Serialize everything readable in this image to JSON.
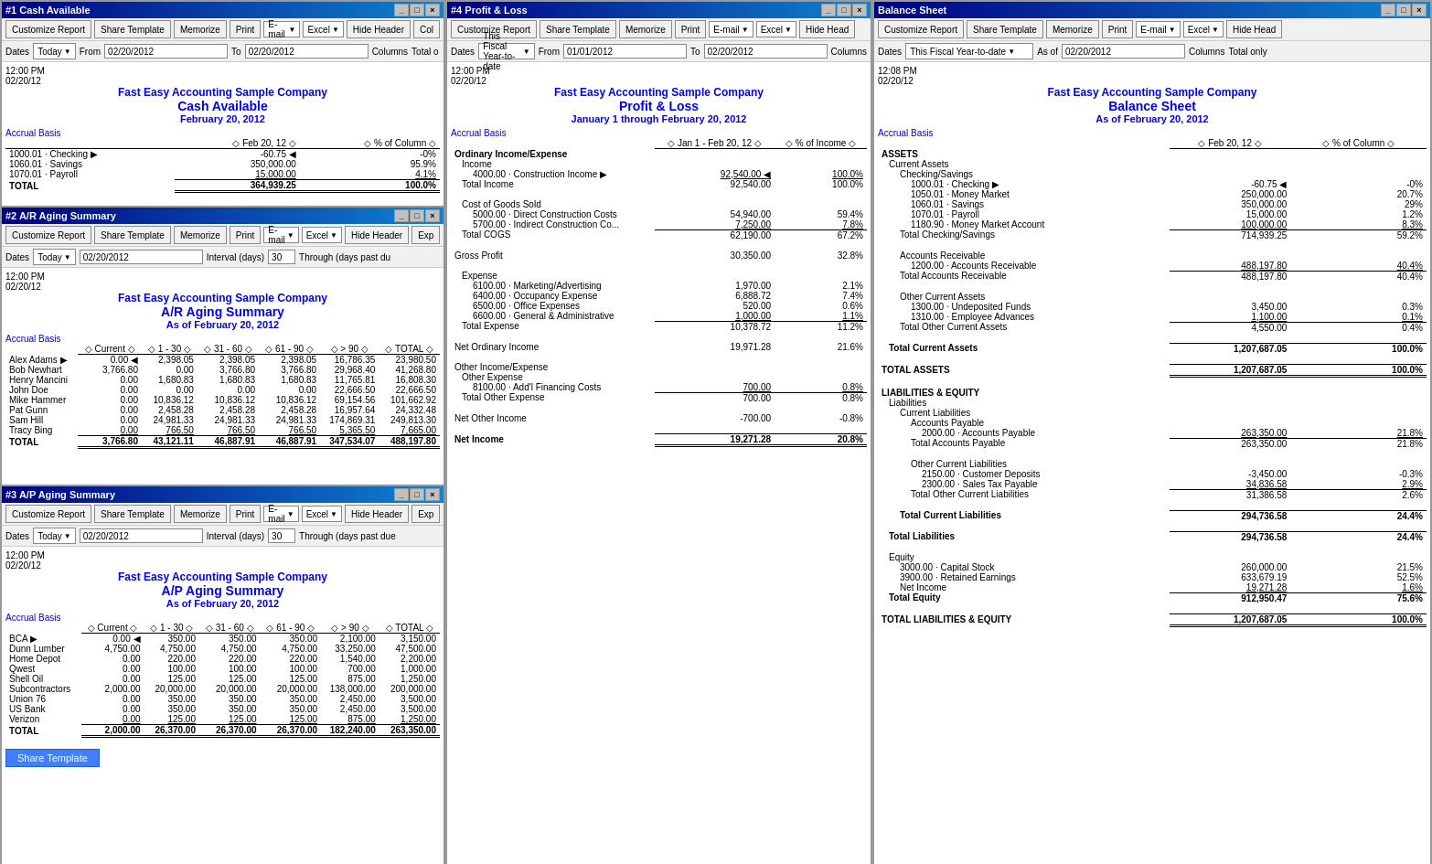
{
  "windows": {
    "cash": {
      "title": "#1 Cash Available",
      "toolbar": {
        "customize": "Customize Report",
        "share": "Share Template",
        "memorize": "Memorize",
        "print": "Print",
        "email": "E-mail",
        "excel": "Excel",
        "hideHeader": "Hide Header",
        "collapse": "Col"
      },
      "dates": {
        "label": "Dates",
        "value": "Today",
        "from_label": "From",
        "from_date": "02/20/2012",
        "to_label": "To",
        "to_date": "02/20/2012",
        "columns": "Columns",
        "total": "Total o"
      },
      "report": {
        "time": "12:00 PM",
        "date": "02/20/12",
        "company": "Fast Easy Accounting Sample Company",
        "title": "Cash Available",
        "subtitle": "February 20, 2012",
        "basis": "Accrual Basis",
        "col1": "Feb 20, 12",
        "col2": "% of Column",
        "rows": [
          {
            "account": "1000.01 · Checking",
            "arrow": "▶",
            "val1": "-60.75",
            "mark": "◀",
            "val2": "-0%"
          },
          {
            "account": "1060.01 · Savings",
            "arrow": "",
            "val1": "350,000.00",
            "mark": "",
            "val2": "95.9%"
          },
          {
            "account": "1070.01 · Payroll",
            "arrow": "",
            "val1": "15,000.00",
            "mark": "",
            "val2": "4.1%"
          },
          {
            "account": "TOTAL",
            "arrow": "",
            "val1": "364,939.25",
            "mark": "",
            "val2": "100.0%",
            "total": true
          }
        ]
      }
    },
    "ar": {
      "title": "#2 A/R Aging Summary",
      "toolbar": {
        "customize": "Customize Report",
        "share": "Share Template",
        "memorize": "Memorize",
        "print": "Print",
        "email": "E-mail",
        "excel": "Excel",
        "hideHeader": "Hide Header",
        "exp": "Exp"
      },
      "dates": {
        "label": "Dates",
        "value": "Today",
        "date": "02/20/2012",
        "interval_label": "Interval (days)",
        "interval": "30",
        "through": "Through (days past du"
      },
      "report": {
        "time": "12:00 PM",
        "date": "02/20/12",
        "company": "Fast Easy Accounting Sample Company",
        "title": "A/R Aging Summary",
        "subtitle": "As of February 20, 2012",
        "basis": "Accrual Basis",
        "cols": [
          "Current",
          "1 - 30",
          "31 - 60",
          "61 - 90",
          "> 90",
          "TOTAL"
        ],
        "rows": [
          {
            "name": "Alex Adams",
            "arrow": "▶",
            "current": "0.00",
            "c1": "2,398.05",
            "c2": "2,398.05",
            "c3": "2,398.05",
            "c4": "16,786.35",
            "total": "23,980.50"
          },
          {
            "name": "Bob Newhart",
            "arrow": "",
            "current": "3,766.80",
            "c1": "0.00",
            "c2": "3,766.80",
            "c3": "3,766.80",
            "c4": "29,968.40",
            "total": "41,268.80"
          },
          {
            "name": "Henry Mancini",
            "arrow": "",
            "current": "0.00",
            "c1": "1,680.83",
            "c2": "1,680.83",
            "c3": "1,680.83",
            "c4": "11,765.81",
            "total": "16,808.30"
          },
          {
            "name": "John Doe",
            "arrow": "",
            "current": "0.00",
            "c1": "0.00",
            "c2": "0.00",
            "c3": "0.00",
            "c4": "22,666.50",
            "total": "22,666.50"
          },
          {
            "name": "Mike Hammer",
            "arrow": "",
            "current": "0.00",
            "c1": "10,836.12",
            "c2": "10,836.12",
            "c3": "10,836.12",
            "c4": "69,154.56",
            "total": "101,662.92"
          },
          {
            "name": "Pat Gunn",
            "arrow": "",
            "current": "0.00",
            "c1": "2,458.28",
            "c2": "2,458.28",
            "c3": "2,458.28",
            "c4": "16,957.64",
            "total": "24,332.48"
          },
          {
            "name": "Sam Hill",
            "arrow": "",
            "current": "0.00",
            "c1": "24,981.33",
            "c2": "24,981.33",
            "c3": "24,981.33",
            "c4": "174,869.31",
            "total": "249,813.30"
          },
          {
            "name": "Tracy Bing",
            "arrow": "",
            "current": "0.00",
            "c1": "766.50",
            "c2": "766.50",
            "c3": "766.50",
            "c4": "5,365.50",
            "total": "7,665.00"
          },
          {
            "name": "TOTAL",
            "arrow": "",
            "current": "3,766.80",
            "c1": "43,121.11",
            "c2": "46,887.91",
            "c3": "46,887.91",
            "c4": "347,534.07",
            "total": "488,197.80",
            "isTotal": true
          }
        ]
      }
    },
    "ap": {
      "title": "#3 A/P Aging Summary",
      "toolbar": {
        "customize": "Customize Report",
        "share": "Share Template",
        "memorize": "Memorize",
        "print": "Print",
        "email": "E-mail",
        "excel": "Excel",
        "hideHeader": "Hide Header",
        "exp": "Exp"
      },
      "dates": {
        "label": "Dates",
        "value": "Today",
        "date": "02/20/2012",
        "interval_label": "Interval (days)",
        "interval": "30",
        "through": "Through (days past due"
      },
      "report": {
        "time": "12:00 PM",
        "date": "02/20/12",
        "company": "Fast Easy Accounting Sample Company",
        "title": "A/P Aging Summary",
        "subtitle": "As of February 20, 2012",
        "basis": "Accrual Basis",
        "cols": [
          "Current",
          "1 - 30",
          "31 - 60",
          "61 - 90",
          "> 90",
          "TOTAL"
        ],
        "rows": [
          {
            "name": "BCA",
            "arrow": "▶",
            "current": "0.00",
            "c1": "350.00",
            "c2": "350.00",
            "c3": "350.00",
            "c4": "2,100.00",
            "total": "3,150.00"
          },
          {
            "name": "Dunn Lumber",
            "arrow": "",
            "current": "4,750.00",
            "c1": "4,750.00",
            "c2": "4,750.00",
            "c3": "4,750.00",
            "c4": "33,250.00",
            "total": "47,500.00"
          },
          {
            "name": "Home Depot",
            "arrow": "",
            "current": "0.00",
            "c1": "220.00",
            "c2": "220.00",
            "c3": "220.00",
            "c4": "1,540.00",
            "total": "2,200.00"
          },
          {
            "name": "Qwest",
            "arrow": "",
            "current": "0.00",
            "c1": "100.00",
            "c2": "100.00",
            "c3": "100.00",
            "c4": "700.00",
            "total": "1,000.00"
          },
          {
            "name": "Shell Oil",
            "arrow": "",
            "current": "0.00",
            "c1": "125.00",
            "c2": "125.00",
            "c3": "125.00",
            "c4": "875.00",
            "total": "1,250.00"
          },
          {
            "name": "Subcontractors",
            "arrow": "",
            "current": "2,000.00",
            "c1": "20,000.00",
            "c2": "20,000.00",
            "c3": "20,000.00",
            "c4": "138,000.00",
            "total": "200,000.00"
          },
          {
            "name": "Union 76",
            "arrow": "",
            "current": "0.00",
            "c1": "350.00",
            "c2": "350.00",
            "c3": "350.00",
            "c4": "2,450.00",
            "total": "3,500.00"
          },
          {
            "name": "US Bank",
            "arrow": "",
            "current": "0.00",
            "c1": "350.00",
            "c2": "350.00",
            "c3": "350.00",
            "c4": "2,450.00",
            "total": "3,500.00"
          },
          {
            "name": "Verizon",
            "arrow": "",
            "current": "0.00",
            "c1": "125.00",
            "c2": "125.00",
            "c3": "125.00",
            "c4": "875.00",
            "total": "1,250.00"
          },
          {
            "name": "TOTAL",
            "arrow": "",
            "current": "2,000.00",
            "c1": "26,370.00",
            "c2": "26,370.00",
            "c3": "26,370.00",
            "c4": "182,240.00",
            "total": "263,350.00",
            "isTotal": true
          }
        ]
      }
    },
    "pl": {
      "title": "#4 Profit & Loss",
      "toolbar": {
        "customize": "Customize Report",
        "share": "Share Template",
        "memorize": "Memorize",
        "print": "Print",
        "email": "E-mail",
        "excel": "Excel",
        "hideHead": "Hide Head"
      },
      "dates": {
        "label": "Dates",
        "value": "This Fiscal Year-to-date",
        "from_label": "From",
        "from_date": "01/01/2012",
        "to_label": "To",
        "to_date": "02/20/2012",
        "columns": "Columns"
      },
      "report": {
        "time": "12:00 PM",
        "date": "02/20/12",
        "company": "Fast Easy Accounting Sample Company",
        "title": "Profit & Loss",
        "subtitle": "January 1 through February 20, 2012",
        "basis": "Accrual Basis",
        "col1": "Jan 1 - Feb 20, 12",
        "col2": "% of Income"
      }
    },
    "bs": {
      "title": "Balance Sheet",
      "toolbar": {
        "customize": "Customize Report",
        "share": "Share Template",
        "memorize": "Memorize",
        "print": "Print",
        "email": "E-mail",
        "excel": "Excel",
        "hideHead": "Hide Head"
      },
      "dates": {
        "label": "Dates",
        "value": "This Fiscal Year-to-date",
        "asof_label": "As of",
        "asof_date": "02/20/2012",
        "columns": "Columns",
        "totalonly": "Total only"
      },
      "report": {
        "time": "12:08 PM",
        "date": "02/20/12",
        "company": "Fast Easy Accounting Sample Company",
        "title": "Balance Sheet",
        "subtitle": "As of February 20, 2012",
        "basis": "Accrual Basis",
        "col1": "Feb 20, 12",
        "col2": "% of Column"
      }
    }
  },
  "shareTemplateDialog": {
    "title": "Share Template",
    "label": "Template"
  }
}
